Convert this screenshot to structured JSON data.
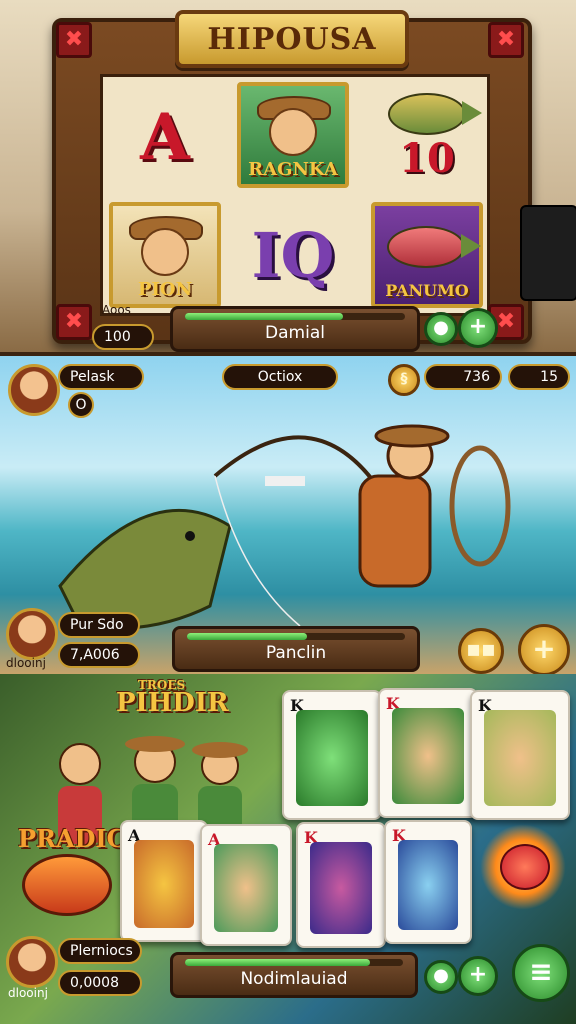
{
  "top": {
    "title": "HIPOUSA",
    "reels": {
      "r1c1": "A",
      "r1c2": "RAGNKA",
      "r1c3": "10",
      "r2c1": "PION",
      "r2c2": "IQ",
      "r2c3": "PANUMO"
    },
    "left_label": "Aoos",
    "left_value": "100",
    "bar_label": "Damial",
    "bar_progress": 0.72,
    "corner_icon": "cross-icon"
  },
  "mid": {
    "player_name": "Pelask",
    "player_sub": "O",
    "center_label": "Octiox",
    "currency1_value": "736",
    "currency2_value": "15",
    "bottom_name": "Pur Sdo",
    "bottom_value": "7,A006",
    "avatar_caption": "dlooinj",
    "bar_label": "Panclin",
    "bar_progress": 0.55
  },
  "bot": {
    "title": "PIHDIR",
    "subtitle": "TROES",
    "left_banner": "PRADICA",
    "player_name": "Plerniocs",
    "player_value": "0,0008",
    "avatar_caption": "dlooinj",
    "bar_label": "Nodimlauiad",
    "bar_progress": 0.85,
    "cards": [
      {
        "rank": "K"
      },
      {
        "rank": "K"
      },
      {
        "rank": "K"
      },
      {
        "rank": "A"
      },
      {
        "rank": "K"
      },
      {
        "rank": "K"
      }
    ]
  }
}
